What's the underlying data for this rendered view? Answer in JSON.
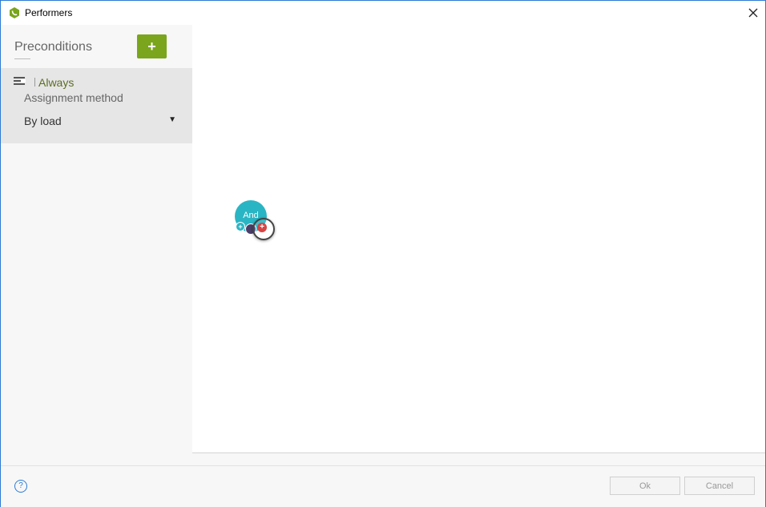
{
  "window": {
    "title": "Performers",
    "accent_color": "#2b7bd4"
  },
  "sidebar": {
    "title": "Preconditions",
    "add_label": "+",
    "add_color": "#7aa51c",
    "rule": {
      "name": "Always",
      "method_label": "Assignment method",
      "method_value": "By load"
    }
  },
  "canvas": {
    "node": {
      "label": "And",
      "color": "#2ab5c4",
      "add_left_label": "+",
      "add_red_label": "+"
    }
  },
  "footer": {
    "help_label": "?",
    "ok_label": "Ok",
    "cancel_label": "Cancel"
  }
}
